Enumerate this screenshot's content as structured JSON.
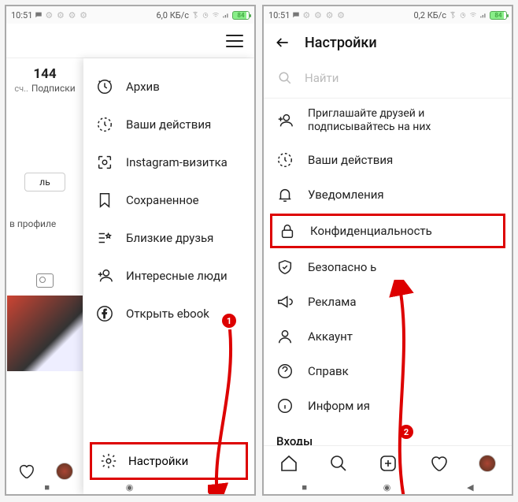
{
  "status": {
    "time": "10:51",
    "msg_icon": "msg",
    "data1": "6,0 КБ/с",
    "data2": "0,2 КБ/с",
    "bt": "bt",
    "alarm": "alarm",
    "wifi": "wifi",
    "signal": "signal",
    "batt": "84"
  },
  "left": {
    "stat_count": "144",
    "stat_label": "Подписки",
    "stat_prefix": "сч..",
    "edit_btn": "ль",
    "profile_link": "в профиле",
    "menu": {
      "archive": "Архив",
      "activity": "Ваши действия",
      "nametag": "Instagram-визитка",
      "saved": "Сохраненное",
      "close_friends": "Близкие друзья",
      "discover": "Интересные люди",
      "facebook": "Открыть         ebook",
      "settings": "Настройки"
    },
    "marker": "1"
  },
  "right": {
    "title": "Настройки",
    "search_placeholder": "Найти",
    "items": {
      "invite": "Приглашайте друзей и подписывайтесь на них",
      "activity": "Ваши действия",
      "notifications": "Уведомления",
      "privacy": "Конфиденциальность",
      "security": "Безопасно     ь",
      "ads": "Реклама",
      "account": "Аккаунт",
      "help": "Справк",
      "about": "Информ     ия"
    },
    "logins": "Входы",
    "marker": "2"
  }
}
